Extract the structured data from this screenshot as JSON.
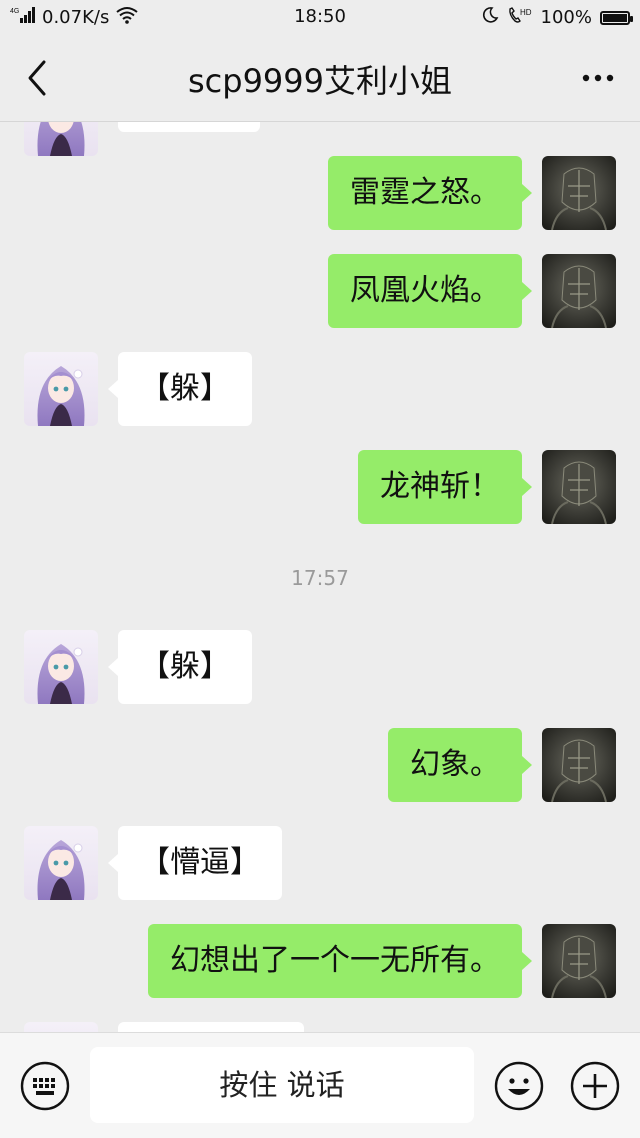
{
  "status_bar": {
    "network": "4G",
    "speed": "0.07K/s",
    "time": "18:50",
    "hd": "HD",
    "battery": "100%",
    "battery_level": 1.0
  },
  "header": {
    "title": "scp9999艾利小姐"
  },
  "messages": [
    {
      "side": "left",
      "text": "",
      "partial": true
    },
    {
      "side": "right",
      "text": "雷霆之怒。"
    },
    {
      "side": "right",
      "text": "凤凰火焰。"
    },
    {
      "side": "left",
      "text": "【躲】"
    },
    {
      "side": "right",
      "text": "龙神斩！"
    },
    {
      "side": "time",
      "text": "17:57"
    },
    {
      "side": "left",
      "text": "【躲】"
    },
    {
      "side": "right",
      "text": "幻象。"
    },
    {
      "side": "left",
      "text": "【懵逼】"
    },
    {
      "side": "right",
      "text": "幻想出了一个一无所有。"
    },
    {
      "side": "left",
      "text": "",
      "partial": true
    }
  ],
  "input_bar": {
    "voice_label": "按住 说话"
  },
  "colors": {
    "outgoing_bubble": "#95ec69",
    "incoming_bubble": "#ffffff",
    "background": "#ededed"
  }
}
